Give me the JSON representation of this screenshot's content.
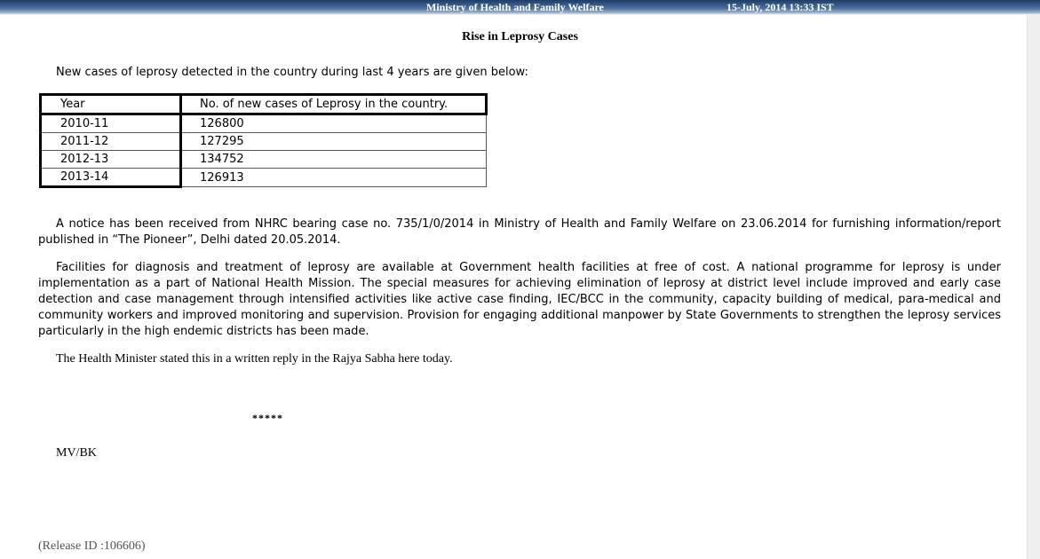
{
  "header": {
    "ministry": "Ministry of Health and Family Welfare",
    "datetime": "15-July, 2014 13:33 IST"
  },
  "document": {
    "title": "Rise in Leprosy Cases",
    "intro": "New cases of leprosy detected in the country during last 4 years are given below:",
    "table": {
      "headers": [
        "Year",
        "No. of new cases of Leprosy in the country."
      ],
      "rows": [
        [
          "2010-11",
          "126800"
        ],
        [
          "2011-12",
          "127295"
        ],
        [
          "2012-13",
          "134752"
        ],
        [
          "2013-14",
          "126913"
        ]
      ]
    },
    "paragraph1": "A notice has been received from NHRC bearing case no. 735/1/0/2014 in Ministry of Health and Family Welfare on 23.06.2014 for furnishing information/report published in “The Pioneer”, Delhi dated 20.05.2014.",
    "paragraph2": "Facilities for diagnosis and treatment of leprosy are available at Government health facilities at free of cost.  A national programme for leprosy is under implementation as a part of National Health Mission.  The special measures for achieving elimination of leprosy at district level include improved and early case detection and case management through intensified activities like active case finding, IEC/BCC in the community, capacity building of medical, para-medical and community workers and improved monitoring and supervision.  Provision for engaging additional manpower by State Governments to strengthen the leprosy services particularly in the high endemic districts has been made.",
    "statement": "The Health Minister stated this in a written reply in the Rajya Sabha here today.",
    "separator": "*****",
    "initials": "MV/BK",
    "release_id": "(Release ID :106606)"
  }
}
